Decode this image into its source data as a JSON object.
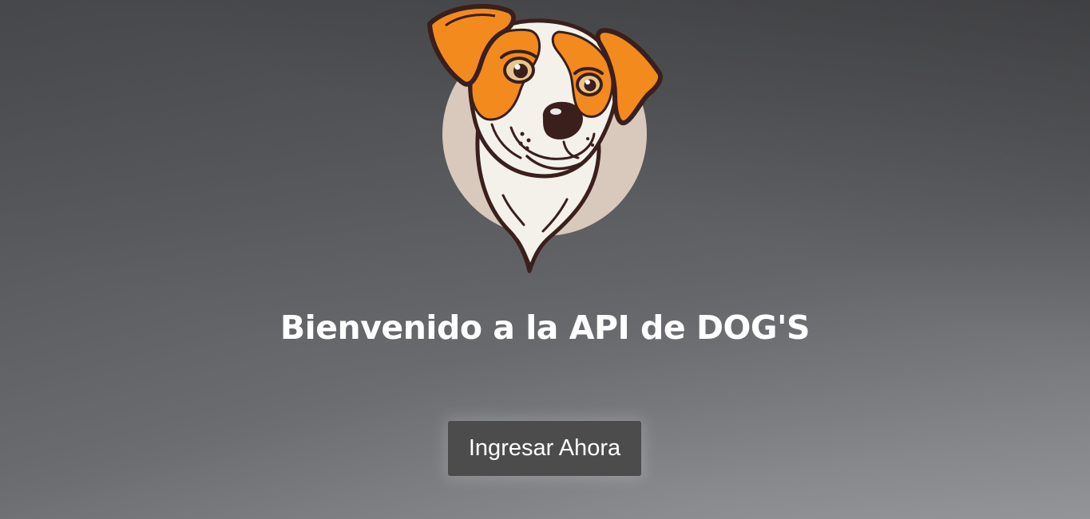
{
  "header": {
    "title": "Bienvenido a la API de DOG'S"
  },
  "actions": {
    "enter_label": "Ingresar Ahora"
  },
  "logo": {
    "icon": "dog-logo-icon",
    "colors": {
      "orange": "#f28a1e",
      "outline": "#3a1f1c",
      "fur": "#f3f1ea",
      "circle": "#d8c9bc"
    }
  }
}
